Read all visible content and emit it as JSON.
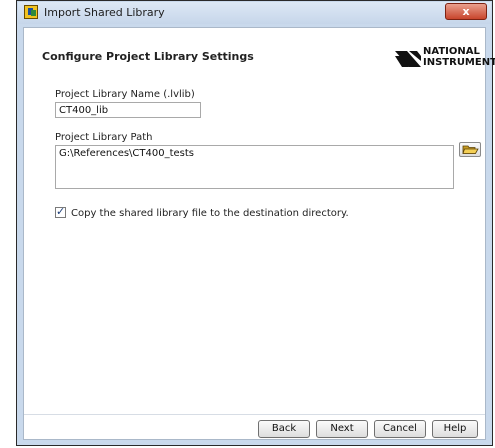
{
  "window": {
    "title": "Import Shared Library",
    "close_label": "x"
  },
  "header": {
    "title": "Configure Project Library Settings",
    "logo": {
      "line1": "NATIONAL",
      "line2": "INSTRUMENTS"
    }
  },
  "form": {
    "library_name": {
      "label": "Project Library Name (.lvlib)",
      "value": "CT400_lib"
    },
    "library_path": {
      "label": "Project Library Path",
      "value": "G:\\References\\CT400_tests"
    },
    "copy_option": {
      "label": "Copy the shared library file to the destination directory.",
      "checked": true
    }
  },
  "buttons": {
    "back": "Back",
    "next": "Next",
    "cancel": "Cancel",
    "help": "Help"
  }
}
